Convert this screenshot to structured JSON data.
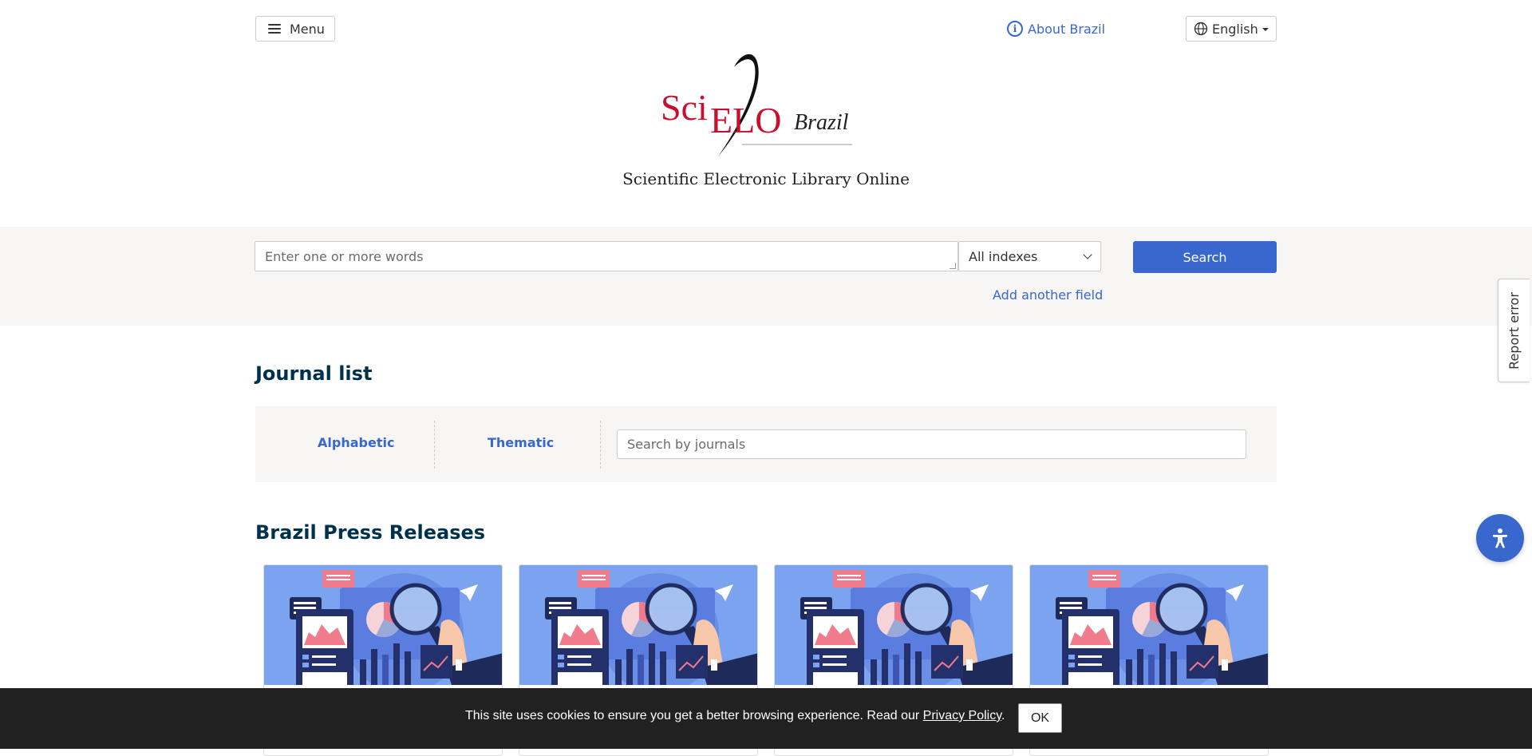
{
  "header": {
    "menu_label": "Menu",
    "about_label": "About Brazil",
    "language_label": "English"
  },
  "logo": {
    "brand_sci": "Sci",
    "brand_elo": "ELO",
    "brand_country": "Brazil",
    "tagline": "Scientific Electronic Library Online"
  },
  "search": {
    "placeholder": "Enter one or more words",
    "index_selected": "All indexes",
    "button_label": "Search",
    "add_field_label": "Add another field"
  },
  "journals": {
    "title": "Journal list",
    "tabs": [
      {
        "label": "Alphabetic"
      },
      {
        "label": "Thematic"
      }
    ],
    "search_placeholder": "Search by journals"
  },
  "press": {
    "title": "Brazil Press Releases",
    "cards": [
      {
        "icon": "press-release-illustration"
      },
      {
        "icon": "press-release-illustration"
      },
      {
        "icon": "press-release-illustration"
      },
      {
        "icon": "press-release-illustration"
      }
    ]
  },
  "side": {
    "report_label": "Report error",
    "accessibility_icon": "accessibility-icon"
  },
  "cookie": {
    "text": "This site uses cookies to ensure you get a better browsing experience. Read our ",
    "link": "Privacy Policy",
    "suffix": ".",
    "ok_label": "OK"
  },
  "colors": {
    "accent": "#3867ce",
    "heading": "#00314c",
    "band": "#f7f6f4",
    "logo_red": "#c8102e",
    "cookie_bg": "#212121"
  }
}
